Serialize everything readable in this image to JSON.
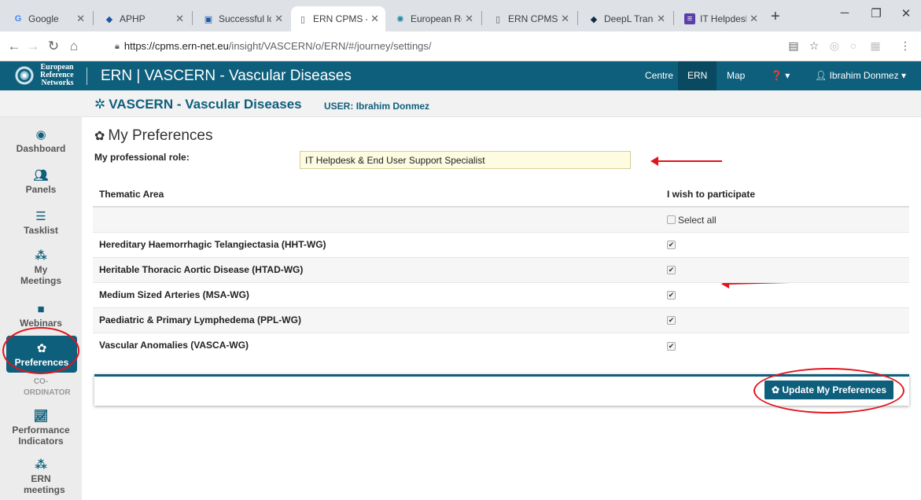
{
  "browser": {
    "tabs": [
      {
        "title": "Google",
        "icon": "google-icon"
      },
      {
        "title": "APHP",
        "icon": "aphp-icon"
      },
      {
        "title": "Successful lo",
        "icon": "doc-icon"
      },
      {
        "title": "ERN CPMS -",
        "icon": "page-icon",
        "active": true
      },
      {
        "title": "European Re",
        "icon": "globe-icon"
      },
      {
        "title": "ERN CPMS T",
        "icon": "page-icon"
      },
      {
        "title": "DeepL Transl",
        "icon": "deepl-icon"
      },
      {
        "title": "IT Helpdesk",
        "icon": "list-icon"
      }
    ],
    "url_base": "https://cpms.ern-net.eu",
    "url_path": "/insight/VASCERN/o/ERN/#/journey/settings/"
  },
  "app": {
    "logo_line1": "European",
    "logo_line2": "Reference",
    "logo_line3": "Networks",
    "title": "ERN | VASCERN - Vascular Diseases",
    "nav": [
      "Centre",
      "ERN",
      "Map"
    ],
    "help_label": "❓ ▾",
    "user_menu": "Ibrahim Donmez ▾",
    "network_name": "VASCERN - Vascular Diseases",
    "user_prefix": "USER:",
    "user_name": "Ibrahim Donmez"
  },
  "sidebar": {
    "items": [
      {
        "label": "Dashboard",
        "icon": "dashboard-icon"
      },
      {
        "label": "Panels",
        "icon": "users-icon"
      },
      {
        "label": "Tasklist",
        "icon": "tasklist-icon"
      },
      {
        "label": "My Meetings",
        "icon": "meetings-icon"
      },
      {
        "label": "Webinars",
        "icon": "video-icon"
      },
      {
        "label": "Preferences",
        "icon": "gear-icon"
      },
      {
        "label": "Performance Indicators",
        "icon": "chart-icon"
      },
      {
        "label": "ERN meetings",
        "icon": "meetings-icon"
      }
    ],
    "coordinator_label": "CO-ORDINATOR"
  },
  "preferences": {
    "heading": "My Preferences",
    "role_label": "My professional role:",
    "role_value": "IT Helpdesk & End User Support Specialist",
    "col_area": "Thematic Area",
    "col_participate": "I wish to participate",
    "select_all": "Select all",
    "areas": [
      {
        "name": "Hereditary Haemorrhagic Telangiectasia (HHT-WG)",
        "checked": true
      },
      {
        "name": "Heritable Thoracic Aortic Disease (HTAD-WG)",
        "checked": true
      },
      {
        "name": "Medium Sized Arteries (MSA-WG)",
        "checked": true
      },
      {
        "name": "Paediatric & Primary Lymphedema (PPL-WG)",
        "checked": true
      },
      {
        "name": "Vascular Anomalies (VASCA-WG)",
        "checked": true
      }
    ],
    "update_button": "Update My Preferences"
  },
  "colors": {
    "brand": "#0e5f7c",
    "annotation": "#e1141e",
    "role_bg": "#fdfbe0"
  }
}
